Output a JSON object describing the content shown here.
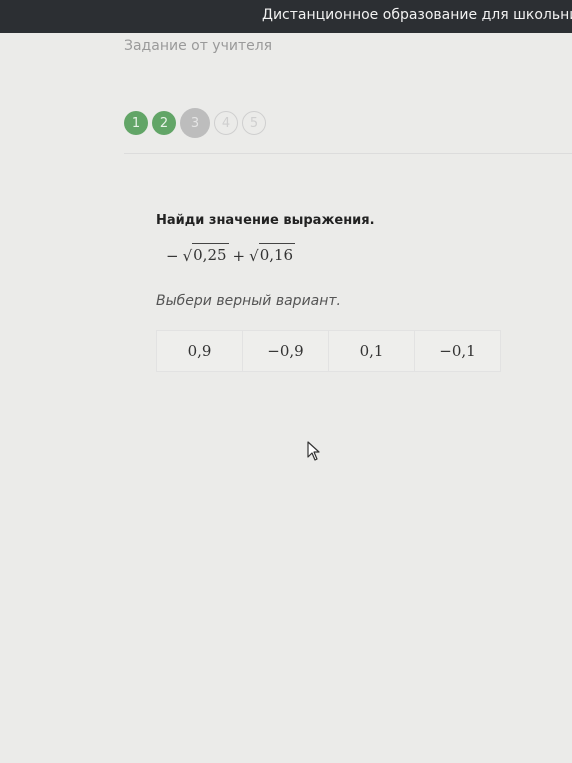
{
  "header": {
    "title": "Дистанционное образование для школьников и дет"
  },
  "page": {
    "subtitle": "Задание от учителя"
  },
  "progress": {
    "steps": [
      {
        "label": "1",
        "state": "done"
      },
      {
        "label": "2",
        "state": "done"
      },
      {
        "label": "3",
        "state": "current"
      },
      {
        "label": "4",
        "state": "todo"
      },
      {
        "label": "5",
        "state": "todo"
      }
    ]
  },
  "task": {
    "title": "Найди значение выражения.",
    "expression": {
      "sign1": "−",
      "radicand1": "0,25",
      "sign2": "+",
      "radicand2": "0,16",
      "radical": "√"
    },
    "instruction": "Выбери верный вариант.",
    "options": [
      "0,9",
      "−0,9",
      "0,1",
      "−0,1"
    ]
  },
  "colors": {
    "header_bg": "#2c2f33",
    "step_done": "#62a567",
    "step_current": "#bdbdbd"
  }
}
